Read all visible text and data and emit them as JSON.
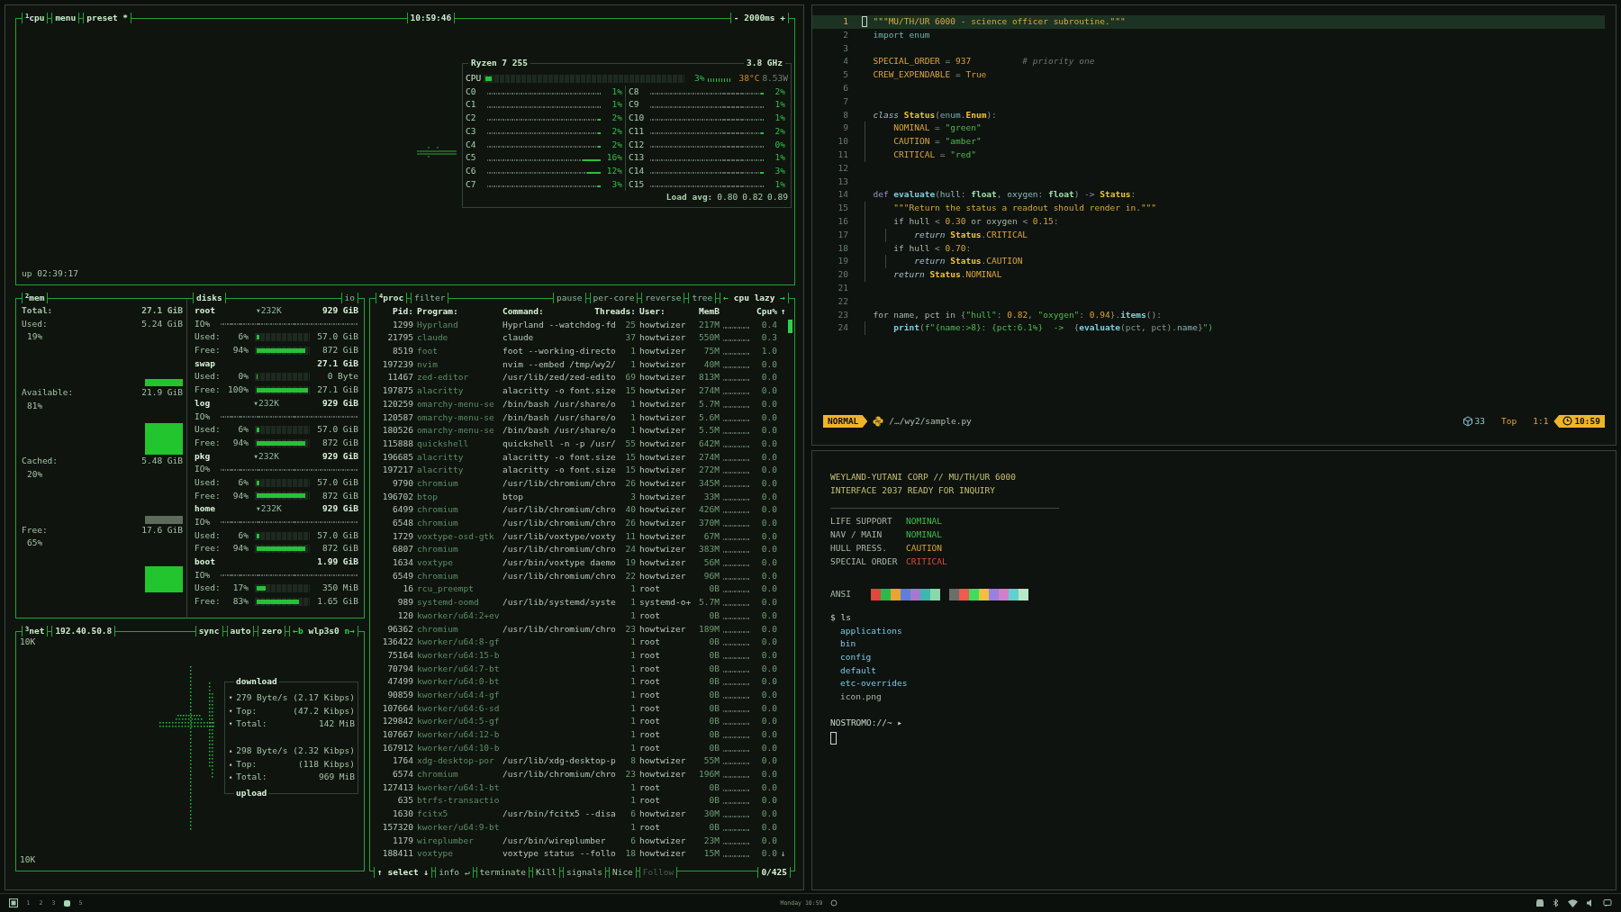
{
  "cpu_panel": {
    "number": "1",
    "title": "cpu",
    "menu": "menu",
    "preset": "preset *",
    "clock": "10:59:46",
    "interval_down": "-",
    "interval": "2000ms",
    "interval_up": "+",
    "uptime": "up 02:39:17",
    "processor": {
      "model": "Ryzen 7 255",
      "frequency": "3.8 GHz",
      "label": "CPU",
      "level": 0.03,
      "percent": "3%",
      "temperature": "38°C",
      "power": "8.53W",
      "cores": [
        {
          "name": "C0",
          "level": 0.01,
          "percent": "1%"
        },
        {
          "name": "C1",
          "level": 0.01,
          "percent": "1%"
        },
        {
          "name": "C2",
          "level": 0.02,
          "percent": "2%"
        },
        {
          "name": "C3",
          "level": 0.02,
          "percent": "2%"
        },
        {
          "name": "C4",
          "level": 0.02,
          "percent": "2%"
        },
        {
          "name": "C5",
          "level": 0.16,
          "percent": "16%"
        },
        {
          "name": "C6",
          "level": 0.12,
          "percent": "12%"
        },
        {
          "name": "C7",
          "level": 0.03,
          "percent": "3%"
        },
        {
          "name": "C8",
          "level": 0.02,
          "percent": "2%"
        },
        {
          "name": "C9",
          "level": 0.01,
          "percent": "1%"
        },
        {
          "name": "C10",
          "level": 0.01,
          "percent": "1%"
        },
        {
          "name": "C11",
          "level": 0.02,
          "percent": "2%"
        },
        {
          "name": "C12",
          "level": 0,
          "percent": "0%"
        },
        {
          "name": "C13",
          "level": 0.01,
          "percent": "1%"
        },
        {
          "name": "C14",
          "level": 0.03,
          "percent": "3%"
        },
        {
          "name": "C15",
          "level": 0.01,
          "percent": "1%"
        }
      ],
      "load_label": "Load avg:",
      "load": [
        "0.80",
        "0.82",
        "0.89"
      ]
    }
  },
  "memory": {
    "number": "2",
    "title": "mem",
    "items": [
      {
        "label": "Total:",
        "value": "27.1 GiB"
      },
      {
        "label": "Used:",
        "value": "5.24 GiB",
        "percent": "19%",
        "color": "#22c52e"
      },
      {
        "label": "Available:",
        "value": "21.9 GiB",
        "percent": "81%",
        "color": "#22c52e"
      },
      {
        "label": "Cached:",
        "value": "5.48 GiB",
        "percent": "20%",
        "color": "#5c6b5c"
      },
      {
        "label": "Free:",
        "value": "17.6 GiB",
        "percent": "65%",
        "color": "#22c52e"
      }
    ]
  },
  "disks": {
    "title": "disks",
    "io_toggle": "io",
    "items": [
      {
        "name": "root",
        "io": "▾232K",
        "size": "929 GiB",
        "io_label": "IO%",
        "meters": [
          {
            "label": "Used:",
            "percent": "6%",
            "level": 0.06,
            "value": "57.0 GiB"
          },
          {
            "label": "Free:",
            "percent": "94%",
            "level": 0.94,
            "value": "872 GiB"
          }
        ]
      },
      {
        "name": "swap",
        "size": "27.1 GiB",
        "meters": [
          {
            "label": "Used:",
            "percent": "0%",
            "level": 0,
            "value": "0 Byte"
          },
          {
            "label": "Free:",
            "percent": "100%",
            "level": 1,
            "value": "27.1 GiB"
          }
        ]
      },
      {
        "name": "log",
        "io": "▾232K",
        "size": "929 GiB",
        "io_label": "IO%",
        "meters": [
          {
            "label": "Used:",
            "percent": "6%",
            "level": 0.06,
            "value": "57.0 GiB"
          },
          {
            "label": "Free:",
            "percent": "94%",
            "level": 0.94,
            "value": "872 GiB"
          }
        ]
      },
      {
        "name": "pkg",
        "io": "▾232K",
        "size": "929 GiB",
        "io_label": "IO%",
        "meters": [
          {
            "label": "Used:",
            "percent": "6%",
            "level": 0.06,
            "value": "57.0 GiB"
          },
          {
            "label": "Free:",
            "percent": "94%",
            "level": 0.94,
            "value": "872 GiB"
          }
        ]
      },
      {
        "name": "home",
        "io": "▾232K",
        "size": "929 GiB",
        "io_label": "IO%",
        "meters": [
          {
            "label": "Used:",
            "percent": "6%",
            "level": 0.06,
            "value": "57.0 GiB"
          },
          {
            "label": "Free:",
            "percent": "94%",
            "level": 0.94,
            "value": "872 GiB"
          }
        ]
      },
      {
        "name": "boot",
        "size": "1.99 GiB",
        "io_label": "IO%",
        "meters": [
          {
            "label": "Used:",
            "percent": "17%",
            "level": 0.17,
            "value": "350 MiB"
          },
          {
            "label": "Free:",
            "percent": "83%",
            "level": 0.83,
            "value": "1.65 GiB"
          }
        ]
      }
    ]
  },
  "network": {
    "number": "3",
    "title": "net",
    "address": "192.40.50.8",
    "controls": [
      "sync",
      "auto",
      "zero"
    ],
    "prev": "←b",
    "interface": "wlp3s0",
    "next": "n→",
    "scale_top": "10K",
    "scale_bottom": "10K",
    "download": {
      "title": "download",
      "rows": [
        {
          "arrow": "▾",
          "label": "279 Byte/s",
          "value": "(2.17 Kibps)"
        },
        {
          "arrow": "▾",
          "label": "Top:",
          "value": "(47.2 Kibps)"
        },
        {
          "arrow": "▾",
          "label": "Total:",
          "value": "142 MiB"
        }
      ]
    },
    "upload": {
      "title": "upload",
      "rows": [
        {
          "arrow": "▴",
          "label": "298 Byte/s",
          "value": "(2.32 Kibps)"
        },
        {
          "arrow": "▴",
          "label": "Top:",
          "value": "(118 Kibps)"
        },
        {
          "arrow": "▴",
          "label": "Total:",
          "value": "969 MiB"
        }
      ]
    }
  },
  "processes": {
    "number": "4",
    "title": "proc",
    "filter": "filter",
    "controls": [
      "pause",
      "per-core",
      "reverse",
      "tree"
    ],
    "sort_prev": "←",
    "sort": "cpu lazy",
    "sort_next": "→",
    "columns": {
      "pid": "Pid:",
      "program": "Program:",
      "command": "Command:",
      "threads": "Threads:",
      "user": "User:",
      "mem": "MemB",
      "cpu": "Cpu%",
      "order": "↑"
    },
    "rows": [
      {
        "pid": "1299",
        "program": "Hyprland",
        "command": "Hyprland --watchdog-fd",
        "threads": "25",
        "user": "howtwizer",
        "mem": "217M",
        "cpu": "0.4"
      },
      {
        "pid": "21795",
        "program": "claude",
        "command": "claude",
        "threads": "37",
        "user": "howtwizer",
        "mem": "550M",
        "cpu": "0.3"
      },
      {
        "pid": "8519",
        "program": "foot",
        "command": "foot --working-directo",
        "threads": "1",
        "user": "howtwizer",
        "mem": "75M",
        "cpu": "1.0"
      },
      {
        "pid": "197239",
        "program": "nvim",
        "command": "nvim --embed /tmp/wy2/",
        "threads": "1",
        "user": "howtwizer",
        "mem": "40M",
        "cpu": "0.0"
      },
      {
        "pid": "11467",
        "program": "zed-editor",
        "command": "/usr/lib/zed/zed-edito",
        "threads": "69",
        "user": "howtwizer",
        "mem": "813M",
        "cpu": "0.0"
      },
      {
        "pid": "197875",
        "program": "alacritty",
        "command": "alacritty -o font.size",
        "threads": "15",
        "user": "howtwizer",
        "mem": "274M",
        "cpu": "0.0"
      },
      {
        "pid": "120259",
        "program": "omarchy-menu-se",
        "command": "/bin/bash /usr/share/o",
        "threads": "1",
        "user": "howtwizer",
        "mem": "5.7M",
        "cpu": "0.0"
      },
      {
        "pid": "120587",
        "program": "omarchy-menu-se",
        "command": "/bin/bash /usr/share/o",
        "threads": "1",
        "user": "howtwizer",
        "mem": "5.6M",
        "cpu": "0.0"
      },
      {
        "pid": "180526",
        "program": "omarchy-menu-se",
        "command": "/bin/bash /usr/share/o",
        "threads": "1",
        "user": "howtwizer",
        "mem": "5.5M",
        "cpu": "0.0"
      },
      {
        "pid": "115888",
        "program": "quickshell",
        "command": "quickshell -n -p /usr/",
        "threads": "55",
        "user": "howtwizer",
        "mem": "642M",
        "cpu": "0.0"
      },
      {
        "pid": "196685",
        "program": "alacritty",
        "command": "alacritty -o font.size",
        "threads": "15",
        "user": "howtwizer",
        "mem": "274M",
        "cpu": "0.0"
      },
      {
        "pid": "197217",
        "program": "alacritty",
        "command": "alacritty -o font.size",
        "threads": "15",
        "user": "howtwizer",
        "mem": "272M",
        "cpu": "0.0"
      },
      {
        "pid": "9790",
        "program": "chromium",
        "command": "/usr/lib/chromium/chro",
        "threads": "26",
        "user": "howtwizer",
        "mem": "345M",
        "cpu": "0.0"
      },
      {
        "pid": "196702",
        "program": "btop",
        "command": "btop",
        "threads": "3",
        "user": "howtwizer",
        "mem": "33M",
        "cpu": "0.0"
      },
      {
        "pid": "6499",
        "program": "chromium",
        "command": "/usr/lib/chromium/chro",
        "threads": "40",
        "user": "howtwizer",
        "mem": "426M",
        "cpu": "0.0"
      },
      {
        "pid": "6548",
        "program": "chromium",
        "command": "/usr/lib/chromium/chro",
        "threads": "26",
        "user": "howtwizer",
        "mem": "370M",
        "cpu": "0.0"
      },
      {
        "pid": "1729",
        "program": "voxtype-osd-gtk",
        "command": "/usr/lib/voxtype/voxty",
        "threads": "11",
        "user": "howtwizer",
        "mem": "67M",
        "cpu": "0.0"
      },
      {
        "pid": "6807",
        "program": "chromium",
        "command": "/usr/lib/chromium/chro",
        "threads": "24",
        "user": "howtwizer",
        "mem": "383M",
        "cpu": "0.0"
      },
      {
        "pid": "1634",
        "program": "voxtype",
        "command": "/usr/bin/voxtype daemo",
        "threads": "19",
        "user": "howtwizer",
        "mem": "56M",
        "cpu": "0.0"
      },
      {
        "pid": "6549",
        "program": "chromium",
        "command": "/usr/lib/chromium/chro",
        "threads": "22",
        "user": "howtwizer",
        "mem": "96M",
        "cpu": "0.0"
      },
      {
        "pid": "16",
        "program": "rcu_preempt",
        "threads": "1",
        "user": "root",
        "mem": "0B",
        "cpu": "0.0"
      },
      {
        "pid": "989",
        "program": "systemd-oomd",
        "command": "/usr/lib/systemd/syste",
        "threads": "1",
        "user": "systemd-o+",
        "mem": "5.7M",
        "cpu": "0.0"
      },
      {
        "pid": "120",
        "program": "kworker/u64:2+ev",
        "threads": "1",
        "user": "root",
        "mem": "0B",
        "cpu": "0.0"
      },
      {
        "pid": "96362",
        "program": "chromium",
        "command": "/usr/lib/chromium/chro",
        "threads": "23",
        "user": "howtwizer",
        "mem": "189M",
        "cpu": "0.0"
      },
      {
        "pid": "136422",
        "program": "kworker/u64:8-gf",
        "threads": "1",
        "user": "root",
        "mem": "0B",
        "cpu": "0.0"
      },
      {
        "pid": "75164",
        "program": "kworker/u64:15-b",
        "threads": "1",
        "user": "root",
        "mem": "0B",
        "cpu": "0.0"
      },
      {
        "pid": "70794",
        "program": "kworker/u64:7-bt",
        "threads": "1",
        "user": "root",
        "mem": "0B",
        "cpu": "0.0"
      },
      {
        "pid": "47499",
        "program": "kworker/u64:0-bt",
        "threads": "1",
        "user": "root",
        "mem": "0B",
        "cpu": "0.0"
      },
      {
        "pid": "90859",
        "program": "kworker/u64:4-gf",
        "threads": "1",
        "user": "root",
        "mem": "0B",
        "cpu": "0.0"
      },
      {
        "pid": "107664",
        "program": "kworker/u64:6-sd",
        "threads": "1",
        "user": "root",
        "mem": "0B",
        "cpu": "0.0"
      },
      {
        "pid": "129842",
        "program": "kworker/u64:5-gf",
        "threads": "1",
        "user": "root",
        "mem": "0B",
        "cpu": "0.0"
      },
      {
        "pid": "107667",
        "program": "kworker/u64:12-b",
        "threads": "1",
        "user": "root",
        "mem": "0B",
        "cpu": "0.0"
      },
      {
        "pid": "167912",
        "program": "kworker/u64:10-b",
        "threads": "1",
        "user": "root",
        "mem": "0B",
        "cpu": "0.0"
      },
      {
        "pid": "1764",
        "program": "xdg-desktop-por",
        "command": "/usr/lib/xdg-desktop-p",
        "threads": "8",
        "user": "howtwizer",
        "mem": "55M",
        "cpu": "0.0"
      },
      {
        "pid": "6574",
        "program": "chromium",
        "command": "/usr/lib/chromium/chro",
        "threads": "23",
        "user": "howtwizer",
        "mem": "196M",
        "cpu": "0.0"
      },
      {
        "pid": "127413",
        "program": "kworker/u64:1-bt",
        "threads": "1",
        "user": "root",
        "mem": "0B",
        "cpu": "0.0"
      },
      {
        "pid": "635",
        "program": "btrfs-transactio",
        "threads": "1",
        "user": "root",
        "mem": "0B",
        "cpu": "0.0"
      },
      {
        "pid": "1630",
        "program": "fcitx5",
        "command": "/usr/bin/fcitx5 --disa",
        "threads": "6",
        "user": "howtwizer",
        "mem": "30M",
        "cpu": "0.0"
      },
      {
        "pid": "157320",
        "program": "kworker/u64:9-bt",
        "threads": "1",
        "user": "root",
        "mem": "0B",
        "cpu": "0.0"
      },
      {
        "pid": "1179",
        "program": "wireplumber",
        "command": "/usr/bin/wireplumber",
        "threads": "6",
        "user": "howtwizer",
        "mem": "23M",
        "cpu": "0.0"
      },
      {
        "pid": "188411",
        "program": "voxtype",
        "command": "voxtype status --follo",
        "threads": "18",
        "user": "howtwizer",
        "mem": "15M",
        "cpu": "0.0"
      }
    ],
    "scroll_down": "↓",
    "actions": [
      {
        "label": "↑ select ↓",
        "disabled": false
      },
      {
        "label": "info ↵",
        "disabled": false
      },
      {
        "label": "terminate",
        "disabled": false
      },
      {
        "label": "Kill",
        "disabled": false
      },
      {
        "label": "signals",
        "disabled": false
      },
      {
        "label": "Nice",
        "disabled": false
      },
      {
        "label": "Follow",
        "disabled": true
      }
    ],
    "count": "0/425"
  },
  "editor": {
    "lines": [
      {
        "number": "1",
        "current": true,
        "tokens": [
          {
            "kind": "doc",
            "text": "\"\"\"MU/TH/UR 6000 - science officer subroutine.\"\"\""
          }
        ]
      },
      {
        "number": "2",
        "current": false,
        "tokens": [
          {
            "kind": "kw",
            "text": "import"
          },
          {
            "kind": "mod",
            "text": " enum"
          }
        ]
      },
      {
        "number": "3",
        "current": false
      },
      {
        "number": "4",
        "current": false,
        "tokens": [
          {
            "kind": "const",
            "text": "SPECIAL_ORDER"
          },
          {
            "kind": "op",
            "text": " = "
          },
          {
            "kind": "num",
            "text": "937"
          },
          {
            "kind": "comment",
            "text": "          # priority one"
          }
        ]
      },
      {
        "number": "5",
        "current": false,
        "tokens": [
          {
            "kind": "const",
            "text": "CREW_EXPENDABLE"
          },
          {
            "kind": "op",
            "text": " = "
          },
          {
            "kind": "num",
            "text": "True"
          }
        ]
      },
      {
        "number": "6",
        "current": false
      },
      {
        "number": "7",
        "current": false
      },
      {
        "number": "8",
        "current": false,
        "tokens": [
          {
            "kind": "kwi",
            "text": "class"
          },
          {
            "kind": "cls",
            "text": " Status"
          },
          {
            "kind": "op",
            "text": "("
          },
          {
            "kind": "mod",
            "text": "enum"
          },
          {
            "kind": "op",
            "text": "."
          },
          {
            "kind": "cls",
            "text": "Enum"
          },
          {
            "kind": "op",
            "text": "):"
          }
        ]
      },
      {
        "number": "9",
        "current": false,
        "tokens": [
          {
            "kind": "const",
            "text": "    NOMINAL"
          },
          {
            "kind": "op",
            "text": " = "
          },
          {
            "kind": "str",
            "text": "\"green\""
          }
        ]
      },
      {
        "number": "10",
        "current": false,
        "tokens": [
          {
            "kind": "const",
            "text": "    CAUTION"
          },
          {
            "kind": "op",
            "text": " = "
          },
          {
            "kind": "str",
            "text": "\"amber\""
          }
        ]
      },
      {
        "number": "11",
        "current": false,
        "tokens": [
          {
            "kind": "const",
            "text": "    CRITICAL"
          },
          {
            "kind": "op",
            "text": " = "
          },
          {
            "kind": "str",
            "text": "\"red\""
          }
        ]
      },
      {
        "number": "12",
        "current": false
      },
      {
        "number": "13",
        "current": false
      },
      {
        "number": "14",
        "current": false,
        "tokens": [
          {
            "kind": "kwd",
            "text": "def"
          },
          {
            "kind": "fn",
            "text": " evaluate"
          },
          {
            "kind": "op",
            "text": "("
          },
          {
            "kind": "param",
            "text": "hull"
          },
          {
            "kind": "op",
            "text": ": "
          },
          {
            "kind": "type",
            "text": "float"
          },
          {
            "kind": "op",
            "text": ", "
          },
          {
            "kind": "param",
            "text": "oxygen"
          },
          {
            "kind": "op",
            "text": ": "
          },
          {
            "kind": "type",
            "text": "float"
          },
          {
            "kind": "op",
            "text": ") -> "
          },
          {
            "kind": "cls",
            "text": "Status"
          },
          {
            "kind": "op",
            "text": ":"
          }
        ]
      },
      {
        "number": "15",
        "current": false,
        "tokens": [
          {
            "kind": "doc",
            "text": "    \"\"\"Return the status a readout should render in.\"\"\""
          }
        ]
      },
      {
        "number": "16",
        "current": false,
        "tokens": [
          {
            "kind": "plain",
            "text": "    if hull "
          },
          {
            "kind": "op",
            "text": "< "
          },
          {
            "kind": "num",
            "text": "0.30"
          },
          {
            "kind": "plain",
            "text": " or oxygen "
          },
          {
            "kind": "op",
            "text": "< "
          },
          {
            "kind": "num",
            "text": "0.15"
          },
          {
            "kind": "op",
            "text": ":"
          }
        ]
      },
      {
        "number": "17",
        "current": false,
        "tokens": [
          {
            "kind": "kwi",
            "text": "        return"
          },
          {
            "kind": "cls",
            "text": " Status"
          },
          {
            "kind": "op",
            "text": "."
          },
          {
            "kind": "const",
            "text": "CRITICAL"
          }
        ]
      },
      {
        "number": "18",
        "current": false,
        "tokens": [
          {
            "kind": "plain",
            "text": "    if hull "
          },
          {
            "kind": "op",
            "text": "< "
          },
          {
            "kind": "num",
            "text": "0.70"
          },
          {
            "kind": "op",
            "text": ":"
          }
        ]
      },
      {
        "number": "19",
        "current": false,
        "tokens": [
          {
            "kind": "kwi",
            "text": "        return"
          },
          {
            "kind": "cls",
            "text": " Status"
          },
          {
            "kind": "op",
            "text": "."
          },
          {
            "kind": "const",
            "text": "CAUTION"
          }
        ]
      },
      {
        "number": "20",
        "current": false,
        "tokens": [
          {
            "kind": "kwi",
            "text": "    return"
          },
          {
            "kind": "cls",
            "text": " Status"
          },
          {
            "kind": "op",
            "text": "."
          },
          {
            "kind": "const",
            "text": "NOMINAL"
          }
        ]
      },
      {
        "number": "21",
        "current": false
      },
      {
        "number": "22",
        "current": false
      },
      {
        "number": "23",
        "current": false,
        "tokens": [
          {
            "kind": "plain",
            "text": "for name, pct in "
          },
          {
            "kind": "op",
            "text": "{"
          },
          {
            "kind": "str",
            "text": "\"hull\""
          },
          {
            "kind": "op",
            "text": ": "
          },
          {
            "kind": "num",
            "text": "0.82"
          },
          {
            "kind": "op",
            "text": ", "
          },
          {
            "kind": "str",
            "text": "\"oxygen\""
          },
          {
            "kind": "op",
            "text": ": "
          },
          {
            "kind": "num",
            "text": "0.94"
          },
          {
            "kind": "op",
            "text": "}."
          },
          {
            "kind": "fn",
            "text": "items"
          },
          {
            "kind": "op",
            "text": "():"
          }
        ]
      },
      {
        "number": "24",
        "current": false,
        "tokens": [
          {
            "kind": "fn",
            "text": "    print"
          },
          {
            "kind": "op",
            "text": "("
          },
          {
            "kind": "str",
            "text": "f\"{name:>8}: {pct:6.1%}  ->  "
          },
          {
            "kind": "op",
            "text": "{"
          },
          {
            "kind": "fn",
            "text": "evaluate"
          },
          {
            "kind": "op",
            "text": "(pct, pct)."
          },
          {
            "kind": "param",
            "text": "name"
          },
          {
            "kind": "op",
            "text": "}"
          },
          {
            "kind": "str",
            "text": "\")"
          }
        ]
      }
    ],
    "status": {
      "mode": "NORMAL",
      "file": "/…/wy2/sample.py",
      "diagnostics": "33",
      "position": "Top",
      "cursor": "1:1",
      "time": "10:59"
    }
  },
  "terminal": {
    "banner": [
      "WEYLAND-YUTANI CORP  //  MU/TH/UR 6000",
      "INTERFACE 2037 READY FOR INQUIRY"
    ],
    "systems": [
      {
        "label": "LIFE SUPPORT",
        "value": "NOMINAL",
        "color": "#3fbf4a"
      },
      {
        "label": "NAV / MAIN",
        "value": "NOMINAL",
        "color": "#3fbf4a"
      },
      {
        "label": "HULL PRESS.",
        "value": "CAUTION",
        "color": "#e0a331"
      },
      {
        "label": "SPECIAL ORDER",
        "value": "CRITICAL",
        "color": "#e0473d"
      }
    ],
    "ansi_label": "ANSI",
    "palettes": [
      {
        "swatches": [
          {
            "color": "#e0473d"
          },
          {
            "color": "#2fb84a"
          },
          {
            "color": "#e8a530"
          },
          {
            "color": "#5f7fd8"
          },
          {
            "color": "#a878d0"
          },
          {
            "color": "#3cb8b0"
          },
          {
            "color": "#88d8a8"
          }
        ]
      },
      {
        "swatches": [
          {
            "color": "#6a6f6a"
          },
          {
            "color": "#f05a4f"
          },
          {
            "color": "#40dc60"
          },
          {
            "color": "#f0c040"
          },
          {
            "color": "#9a80e0"
          },
          {
            "color": "#d080c8"
          },
          {
            "color": "#60d0d0"
          },
          {
            "color": "#b8e8c8"
          }
        ]
      }
    ],
    "command": "$ ls",
    "listing": [
      {
        "name": "applications",
        "kind": "dir"
      },
      {
        "name": "bin",
        "kind": "dir"
      },
      {
        "name": "config",
        "kind": "dir"
      },
      {
        "name": "default",
        "kind": "dir"
      },
      {
        "name": "etc-overrides",
        "kind": "dir"
      },
      {
        "name": "icon.png",
        "kind": "file"
      }
    ],
    "prompt": "NOSTROMO://~ ▸"
  },
  "taskbar": {
    "workspaces": [
      {
        "label": "1",
        "selected": false
      },
      {
        "label": "2",
        "selected": false
      },
      {
        "label": "3",
        "selected": false
      },
      {
        "selected": true
      },
      {
        "label": "5",
        "selected": false
      }
    ],
    "clock": "Monday 10:59"
  }
}
